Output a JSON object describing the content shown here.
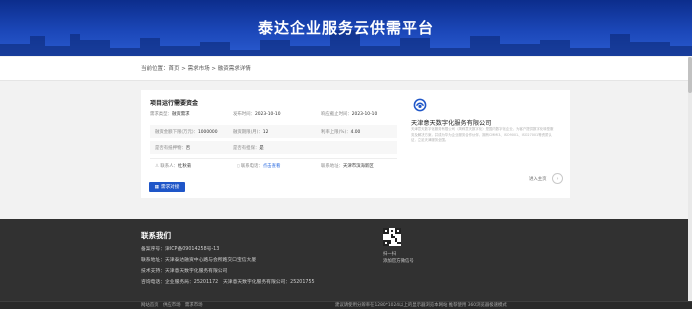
{
  "banner": {
    "title": "泰达企业服务云供需平台"
  },
  "breadcrumb": {
    "prefix": "当前位置：",
    "items": [
      "首页",
      "需求市场",
      "融资需求详情"
    ],
    "separator": " > "
  },
  "demand": {
    "title": "项目运行需要资金",
    "type_label": "需求类型：",
    "type_value": "融资需求",
    "publish_label": "发布时间：",
    "publish_value": "2023-10-10",
    "deadline_label": "响应截止时间：",
    "deadline_value": "2023-10-10",
    "amount_label": "融资金额下限(万元)：",
    "amount_value": "1000000",
    "term_label": "融资期限(月)：",
    "term_value": "12",
    "rate_label": "利率上限(%)：",
    "rate_value": "4.00",
    "collateral_label": "是否有抵押物：",
    "collateral_value": "否",
    "guarantee_label": "是否有担保：",
    "guarantee_value": "是",
    "contact_label": "联系人：",
    "contact_value": "杜秋菊",
    "phone_label": "联系电话：",
    "phone_value": "点击查看",
    "address_label": "联系地址：",
    "address_value": "天津市滨海新区",
    "button_label": "需求对接"
  },
  "company": {
    "name": "天津意天数字化服务有限公司",
    "description": "天津意天数字化服务有限公司（简称意天数字化）是国内数字化企业，为客户提供数字化转型服务及解决方案，并成为华为企业服务合作伙伴，拥有CMMI3、ISO9001、ISO27001等资质认证，立足天津服务全国。",
    "enter_label": "进入主页",
    "enter_icon": "chevron-right-icon"
  },
  "footer": {
    "heading": "联系我们",
    "icp": "备案序号：津ICP备09014258号-13",
    "address": "联系地址：天津泰达融资中心路与会所路交口宝信大厦",
    "support": "技术支持：天津意天数字化服务有限公司",
    "phones": "咨询电话：企业服务局：25201172　天津意天数字化服务有限公司：25201755",
    "qr_line1": "扫一扫",
    "qr_line2": "添加官方微信号",
    "bottom_left": "网站首页　供应市场　需求市场",
    "bottom_right": "建议请使用分辨率在1280*1024以上的显示器浏览本网站 推荐使用 360浏览器极速模式"
  },
  "colors": {
    "banner": "#1b47b8",
    "accent": "#1f56c8",
    "link": "#2b6be0",
    "footer": "#313131"
  }
}
